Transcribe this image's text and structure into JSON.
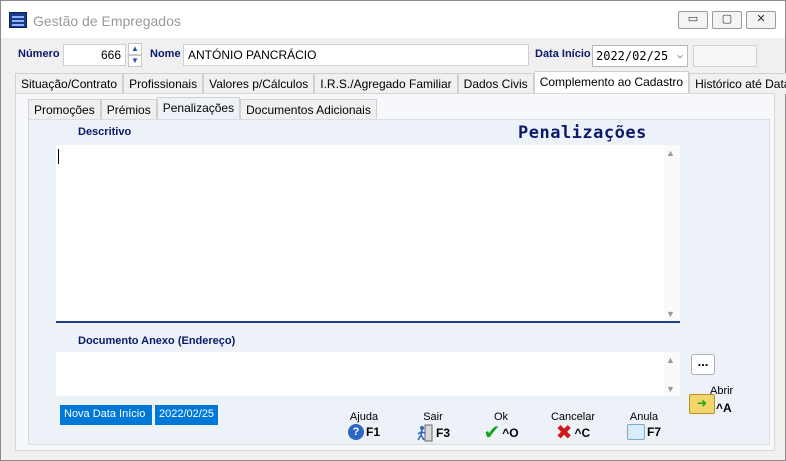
{
  "window": {
    "title": "Gestão de Empregados",
    "controls": {
      "minimize": "▭",
      "maximize": "▢",
      "close": "✕"
    }
  },
  "header": {
    "numero_label": "Número",
    "numero_value": "666",
    "nome_label": "Nome",
    "nome_value": "ANTÓNIO PANCRÁCIO",
    "data_inicio_label": "Data Início",
    "data_inicio_value": "2022/02/25",
    "extra_value": ""
  },
  "main_tabs": [
    "Situação/Contrato",
    "Profissionais",
    "Valores p/Cálculos",
    "I.R.S./Agregado Familiar",
    "Dados Civis",
    "Complemento ao Cadastro",
    "Histórico até Data"
  ],
  "main_tab_active": "Complemento ao Cadastro",
  "sub_tabs": [
    "Promoções",
    "Prémios",
    "Penalizações",
    "Documentos Adicionais"
  ],
  "sub_tab_active": "Penalizações",
  "section": {
    "heading": "Penalizações",
    "descritivo_label": "Descritivo",
    "descritivo_value": "",
    "anexo_label": "Documento Anexo (Endereço)",
    "anexo_value": "",
    "browse_label": "...",
    "abrir_label": "Abrir",
    "abrir_key": "^A"
  },
  "status": {
    "nova_data_label": "Nova Data Início",
    "nova_data_value": "2022/02/25"
  },
  "actions": [
    {
      "label": "Ajuda",
      "key": "F1",
      "icon": "help-icon"
    },
    {
      "label": "Sair",
      "key": "F3",
      "icon": "exit-icon"
    },
    {
      "label": "Ok",
      "key": "^O",
      "icon": "checkmark-icon"
    },
    {
      "label": "Cancelar",
      "key": "^C",
      "icon": "cancel-x-icon"
    },
    {
      "label": "Anula",
      "key": "F7",
      "icon": "annul-icon"
    }
  ],
  "colors": {
    "label_navy": "#0a1a6a",
    "status_blue": "#0078d7",
    "ok_green": "#1aa31a",
    "cancel_red": "#d11a1a"
  }
}
